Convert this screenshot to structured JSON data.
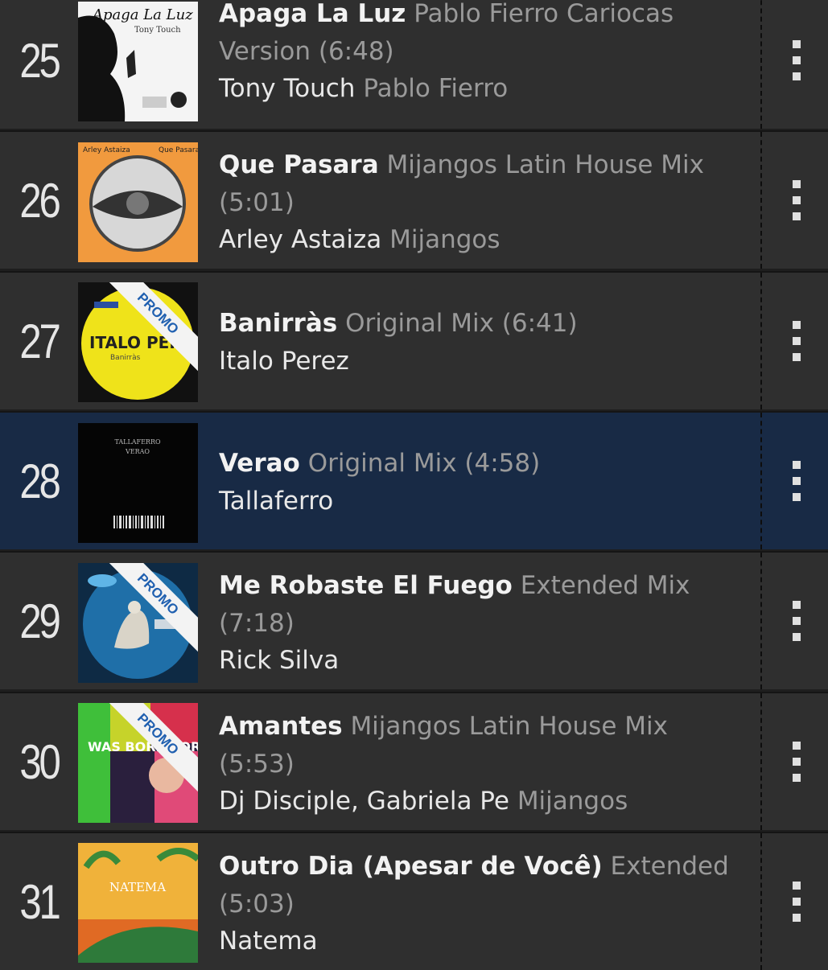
{
  "tracks": [
    {
      "rank": "25",
      "title": "Apaga La Luz",
      "mix": "Pablo Fierro Cariocas Version (6:48)",
      "artist": "Tony Touch",
      "remixer": "Pablo Fierro",
      "art_text": "Apaga La Luz",
      "art_sub": "Tony Touch"
    },
    {
      "rank": "26",
      "title": "Que Pasara",
      "mix": "Mijangos Latin House Mix (5:01)",
      "artist": "Arley Astaiza",
      "remixer": "Mijangos",
      "art_text": "Arley Astaiza",
      "art_sub": "Que Pasara"
    },
    {
      "rank": "27",
      "title": "Banirràs",
      "mix": "Original Mix (6:41)",
      "artist": "Italo Perez",
      "remixer": "",
      "art_text": "ITALO PEREZ",
      "art_sub": "Banirràs"
    },
    {
      "rank": "28",
      "title": "Verao",
      "mix": "Original Mix (4:58)",
      "artist": "Tallaferro",
      "remixer": "",
      "art_text": "TALLAFERRO",
      "art_sub": "VERAO"
    },
    {
      "rank": "29",
      "title": "Me Robaste El Fuego",
      "mix": "Extended Mix (7:18)",
      "artist": "Rick Silva",
      "remixer": "",
      "art_text": "",
      "art_sub": ""
    },
    {
      "rank": "30",
      "title": "Amantes",
      "mix": "Mijangos Latin House Mix (5:53)",
      "artist": "Dj Disciple, Gabriela Pe",
      "remixer": "Mijangos",
      "art_text": "WAS BORN FOR THIS",
      "art_sub": ""
    },
    {
      "rank": "31",
      "title": "Outro Dia (Apesar de Você)",
      "mix": "Extended (5:03)",
      "artist": "Natema",
      "remixer": "",
      "art_text": "NATEMA",
      "art_sub": ""
    }
  ],
  "promo_label": "PROMO",
  "colors": {
    "row_bg": "#2f2f2f",
    "active_bg": "#182a45",
    "promo_text": "#2060b0"
  }
}
